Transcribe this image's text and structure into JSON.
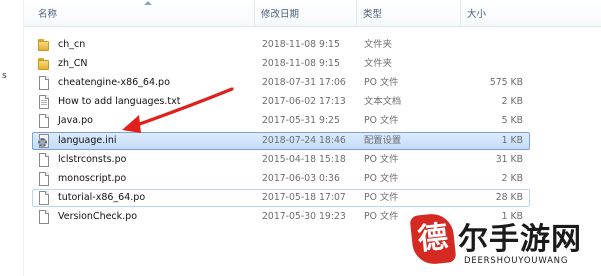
{
  "left_fragment": "s",
  "columns": {
    "name": "名称",
    "date": "修改日期",
    "type": "类型",
    "size": "大小"
  },
  "files": [
    {
      "name": "ch_cn",
      "date": "2018-11-08 9:15",
      "type": "文件夹",
      "size": "",
      "icon": "folder-icon"
    },
    {
      "name": "zh_CN",
      "date": "2018-11-08 9:15",
      "type": "文件夹",
      "size": "",
      "icon": "folder-icon"
    },
    {
      "name": "cheatengine-x86_64.po",
      "date": "2018-07-31 17:06",
      "type": "PO 文件",
      "size": "575 KB",
      "icon": "po-file-icon"
    },
    {
      "name": "How to add languages.txt",
      "date": "2017-06-02 17:13",
      "type": "文本文档",
      "size": "2 KB",
      "icon": "text-file-icon"
    },
    {
      "name": "Java.po",
      "date": "2017-05-31 9:25",
      "type": "PO 文件",
      "size": "5 KB",
      "icon": "po-file-icon"
    },
    {
      "name": "language.ini",
      "date": "2018-07-24 18:46",
      "type": "配置设置",
      "size": "1 KB",
      "icon": "config-file-icon"
    },
    {
      "name": "lclstrconsts.po",
      "date": "2015-04-18 15:18",
      "type": "PO 文件",
      "size": "31 KB",
      "icon": "po-file-icon"
    },
    {
      "name": "monoscript.po",
      "date": "2017-06-03 0:36",
      "type": "PO 文件",
      "size": "2 KB",
      "icon": "po-file-icon"
    },
    {
      "name": "tutorial-x86_64.po",
      "date": "2017-05-18 17:07",
      "type": "PO 文件",
      "size": "28 KB",
      "icon": "po-file-icon"
    },
    {
      "name": "VersionCheck.po",
      "date": "2017-05-30 19:23",
      "type": "PO 文件",
      "size": "1 KB",
      "icon": "po-file-icon"
    }
  ],
  "selected_index": 5,
  "hovered_index": 8,
  "annotation": {
    "color": "#e0201c",
    "points_to": "language.ini"
  },
  "watermark": {
    "seal_char": "德",
    "text": "尔手游网",
    "subtext": "DEERSHOUYOUWANG",
    "seal_color": "#d42a22"
  }
}
